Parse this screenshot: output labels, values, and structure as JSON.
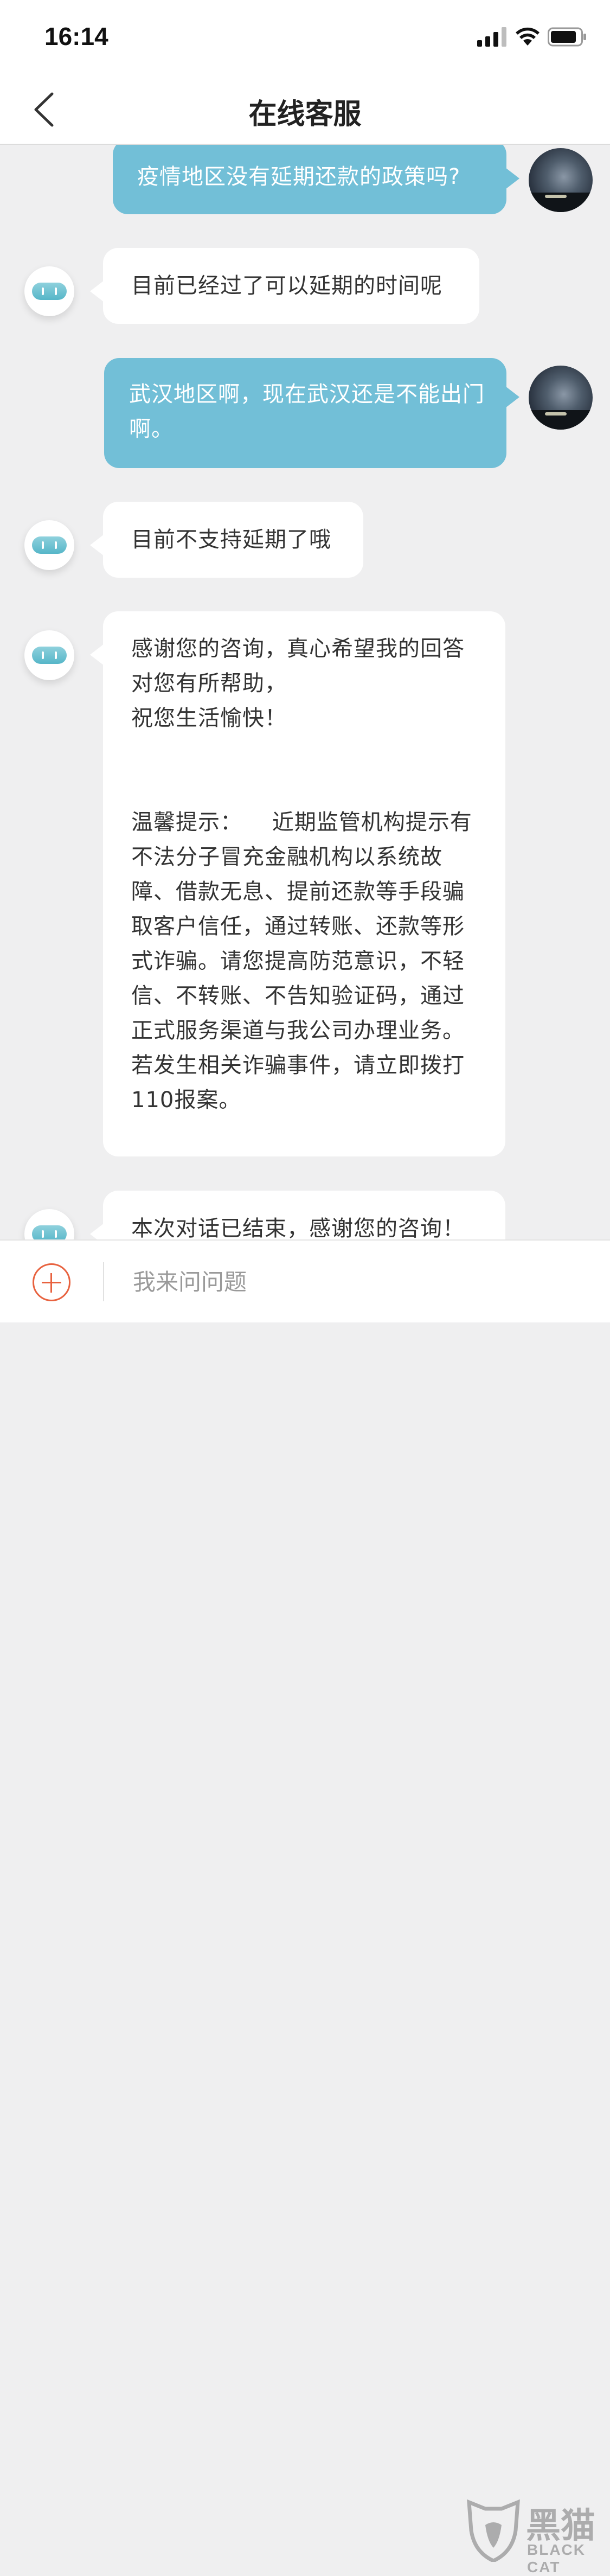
{
  "status_bar": {
    "time": "16:14"
  },
  "nav": {
    "title": "在线客服"
  },
  "messages": [
    {
      "from": "user",
      "text": "疫情地区没有延期还款的政策吗?"
    },
    {
      "from": "bot",
      "text": "目前已经过了可以延期的时间呢"
    },
    {
      "from": "user",
      "text": "武汉地区啊，现在武汉还是不能出门啊。"
    },
    {
      "from": "bot",
      "text": "目前不支持延期了哦"
    },
    {
      "from": "bot",
      "text": "感谢您的咨询，真心希望我的回答对您有所帮助，\n祝您生活愉快！\n\n\n温馨提示：    近期监管机构提示有不法分子冒充金融机构以系统故障、借款无息、提前还款等手段骗取客户信任，通过转账、还款等形式诈骗。请您提高防范意识，不轻信、不转账、不告知验证码，通过正式服务渠道与我公司办理业务。若发生相关诈骗事件，请立即拨打110报案。"
    },
    {
      "from": "bot",
      "text": "本次对话已结束，感谢您的咨询！"
    }
  ],
  "input": {
    "placeholder": "我来问问题"
  },
  "watermark": {
    "brand": "黑猫",
    "sub": "BLACK CAT"
  },
  "colors": {
    "user_bubble": "#72bfd7",
    "bot_bubble": "#ffffff",
    "accent": "#e8623f"
  },
  "icons": [
    "signal-icon",
    "wifi-icon",
    "battery-icon",
    "back-chevron-icon",
    "bot-avatar-icon",
    "add-icon"
  ]
}
